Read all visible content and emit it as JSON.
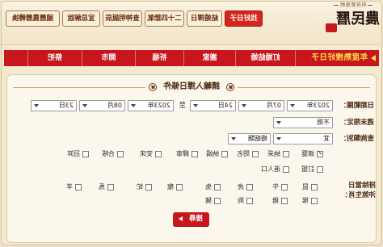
{
  "logo": {
    "tagline": "科技紫微網",
    "name": "農民曆"
  },
  "tabs": [
    {
      "label": "找好日子",
      "active": true
    },
    {
      "label": "結婚擇日",
      "active": false
    },
    {
      "label": "二十四節氣",
      "active": false
    },
    {
      "label": "查神明誕辰",
      "active": false
    },
    {
      "label": "宜忌解說",
      "active": false
    },
    {
      "label": "國曆農曆轉換",
      "active": false
    }
  ],
  "hot_menu": {
    "title": "年度熱搜好日子",
    "items": [
      "訂婚結婚",
      "搬家",
      "祈福",
      "開市",
      "祭祀"
    ]
  },
  "form": {
    "title": "請輸入擇日條件",
    "date_range": {
      "label": "日期範圍：",
      "from_year": "2023年",
      "from_month": "07月",
      "from_day": "24日",
      "to": "至",
      "to_year": "2023年",
      "to_month": "08月",
      "to_day": "23日"
    },
    "weekend": {
      "label": "週末限定：",
      "value": "不限"
    },
    "category": {
      "label": "查詢類別：",
      "type": "宜",
      "group": "婚姻類",
      "options": [
        {
          "label": "嫁娶",
          "checked": true
        },
        {
          "label": "納采",
          "checked": false
        },
        {
          "label": "問名",
          "checked": false
        },
        {
          "label": "納婿",
          "checked": false
        },
        {
          "label": "歸寧",
          "checked": false
        },
        {
          "label": "安床",
          "checked": false
        },
        {
          "label": "合帳",
          "checked": false
        },
        {
          "label": "冠笄",
          "checked": false
        },
        {
          "label": "訂盟",
          "checked": false
        },
        {
          "label": "進人口",
          "checked": false
        }
      ]
    },
    "zodiac": {
      "label_line1": "排除當日",
      "label_line2": "沖煞生肖：",
      "options": [
        "鼠",
        "牛",
        "虎",
        "兔",
        "龍",
        "蛇",
        "馬",
        "羊",
        "猴",
        "雞",
        "狗",
        "豬"
      ]
    },
    "search_label": "搜尋"
  },
  "icons": {
    "hot_title": "arrow-right-icon",
    "select": "chevron-down-icon",
    "title_decor": "circle-cross-icon",
    "search_button": "arrow-right-icon"
  },
  "colors": {
    "brand_red": "#c8161d",
    "hot_title_yellow": "#ffe04a",
    "text_brown": "#4a2812",
    "page_beige": "#f4ead2"
  }
}
